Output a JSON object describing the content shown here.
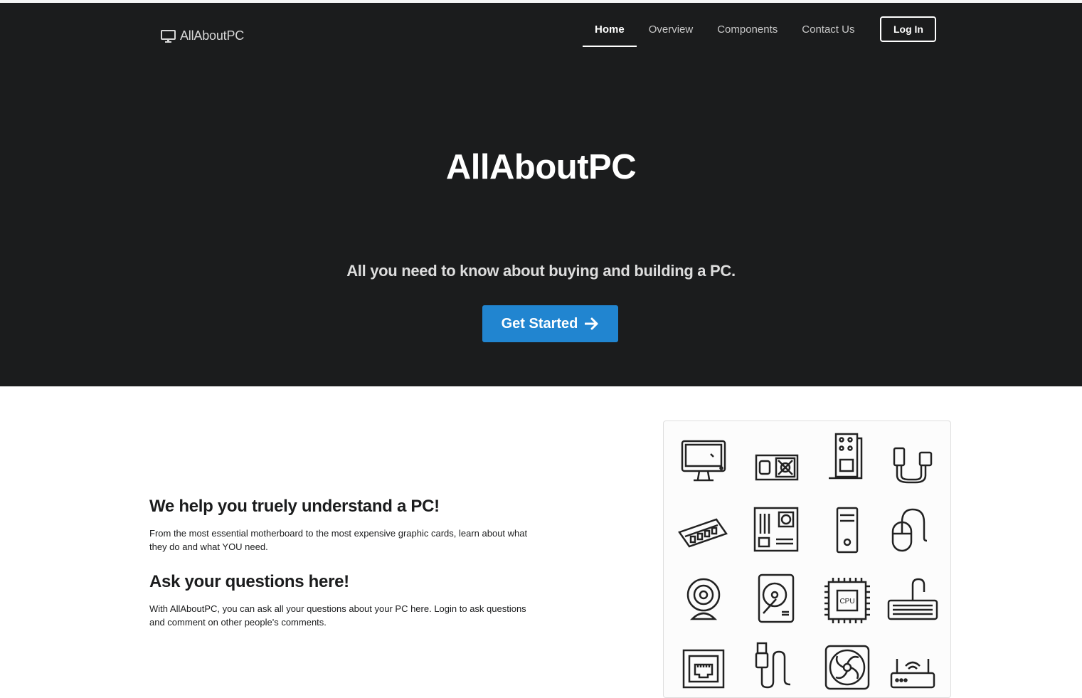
{
  "brand": {
    "name": "AllAboutPC",
    "icon": "monitor-icon"
  },
  "nav": {
    "items": [
      {
        "label": "Home",
        "active": true
      },
      {
        "label": "Overview",
        "active": false
      },
      {
        "label": "Components",
        "active": false
      },
      {
        "label": "Contact Us",
        "active": false
      }
    ],
    "login_label": "Log In"
  },
  "hero": {
    "title": "AllAboutPC",
    "subtitle": "All you need to know about buying and building a PC.",
    "cta_label": "Get Started",
    "cta_icon": "arrow-right-icon"
  },
  "content": {
    "heading1": "We help you truely understand a PC!",
    "text1": "From the most essential motherboard to the most expensive graphic cards, learn about what they do and what YOU need.",
    "heading2": "Ask your questions here!",
    "text2": "With AllAboutPC, you can ask all your questions about your PC here. Login to ask questions and comment on other people's comments."
  },
  "image": {
    "icons": [
      "monitor-icon",
      "power-supply-icon",
      "sound-card-icon",
      "cable-connector-icon",
      "ram-icon",
      "motherboard-icon",
      "pc-tower-icon",
      "mouse-icon",
      "webcam-icon",
      "hard-drive-icon",
      "cpu-icon",
      "keyboard-icon",
      "ethernet-port-icon",
      "usb-cable-icon",
      "cooling-fan-icon",
      "router-icon"
    ],
    "cpu_label": "CPU"
  },
  "colors": {
    "hero_bg": "#1b1c1d",
    "accent": "#2185d0",
    "text": "#1b1c1d"
  }
}
